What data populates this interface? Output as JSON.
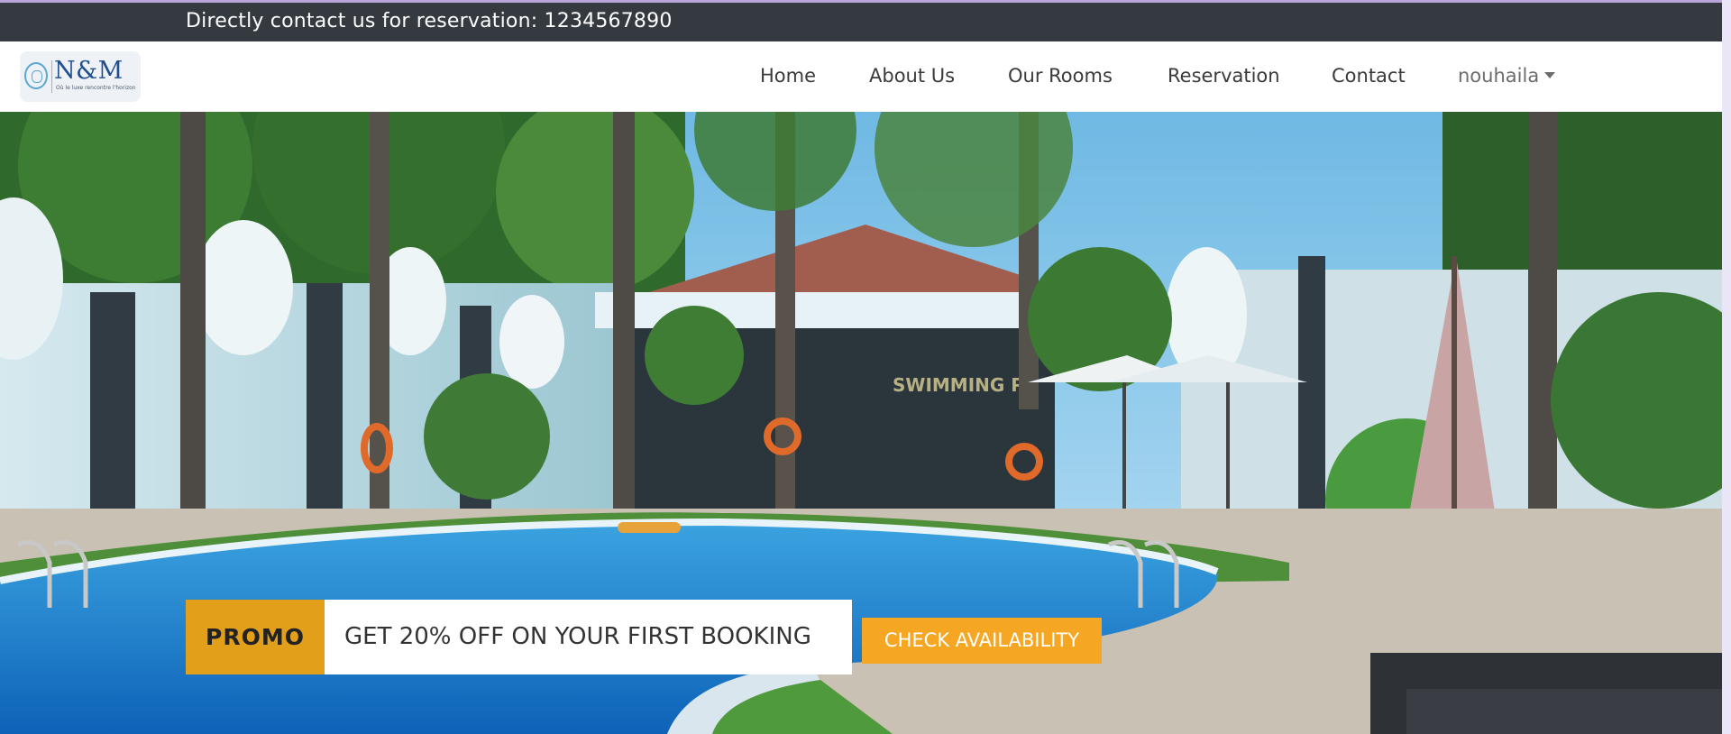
{
  "topbar": {
    "contact_text": "Directly contact us for reservation: 1234567890"
  },
  "logo": {
    "text": "N&M",
    "tagline": "Où le luxe rencontre l'horizon"
  },
  "nav": {
    "items": [
      "Home",
      "About Us",
      "Our Rooms",
      "Reservation",
      "Contact"
    ],
    "user": "nouhaila"
  },
  "hero": {
    "sign_text": "SWIMMING PO",
    "promo_label": "PROMO",
    "promo_text": "GET 20% OFF ON YOUR FIRST BOOKING",
    "cta_label": "CHECK AVAILABILITY"
  },
  "colors": {
    "topbar_bg": "#343a40",
    "promo_accent": "#e19f1a",
    "cta": "#f5a623"
  }
}
